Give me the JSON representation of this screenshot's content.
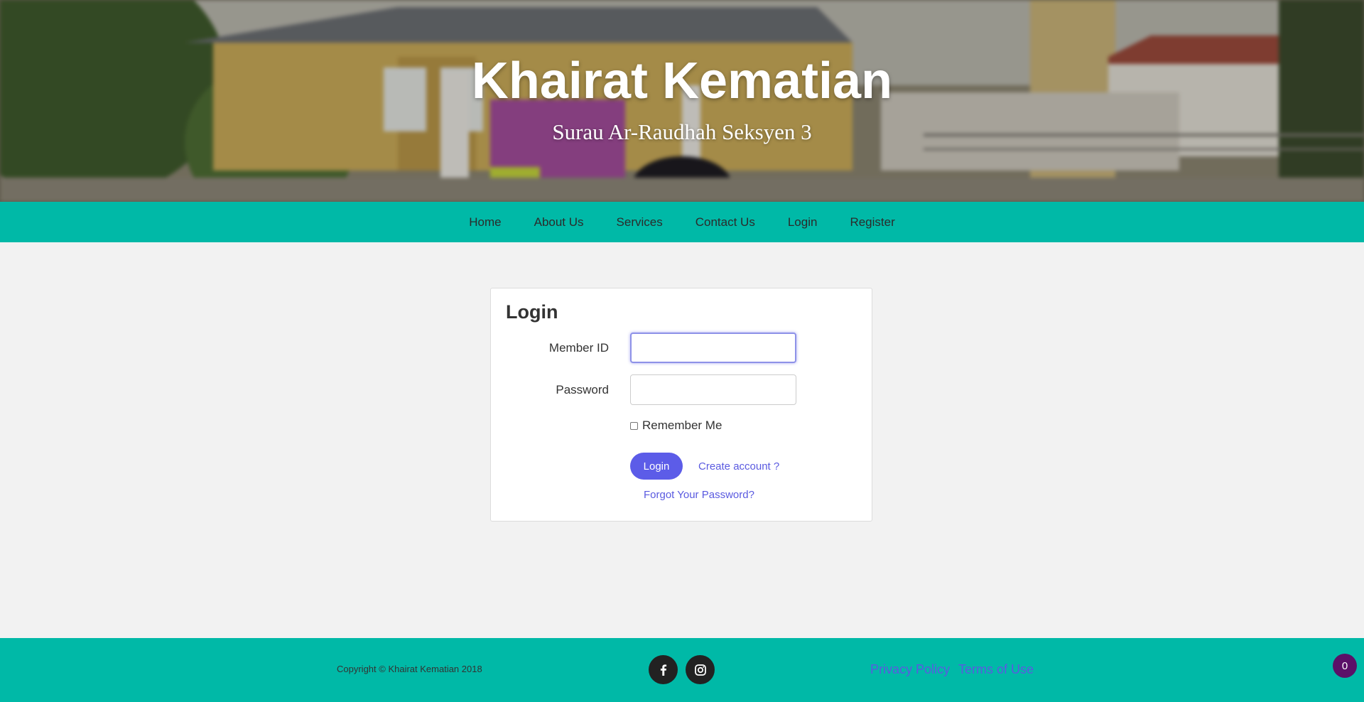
{
  "hero": {
    "title": "Khairat Kematian",
    "subtitle": "Surau Ar-Raudhah Seksyen 3"
  },
  "nav": {
    "items": [
      {
        "label": "Home"
      },
      {
        "label": "About Us"
      },
      {
        "label": "Services"
      },
      {
        "label": "Contact Us"
      },
      {
        "label": "Login"
      },
      {
        "label": "Register"
      }
    ]
  },
  "login": {
    "title": "Login",
    "member_id_label": "Member ID",
    "member_id_value": "",
    "password_label": "Password",
    "password_value": "",
    "remember_label": "Remember Me",
    "remember_checked": false,
    "submit_label": "Login",
    "create_account_label": "Create account ?",
    "forgot_password_label": "Forgot Your Password?"
  },
  "footer": {
    "copyright": "Copyright © Khairat Kematian 2018",
    "social": [
      {
        "icon": "facebook-icon"
      },
      {
        "icon": "instagram-icon"
      }
    ],
    "links": [
      {
        "label": "Privacy Policy"
      },
      {
        "label": "Terms of Use"
      }
    ],
    "counter": "0"
  },
  "colors": {
    "teal": "#00b9a7",
    "accent": "#5c5ce8",
    "badge": "#5b1068"
  }
}
